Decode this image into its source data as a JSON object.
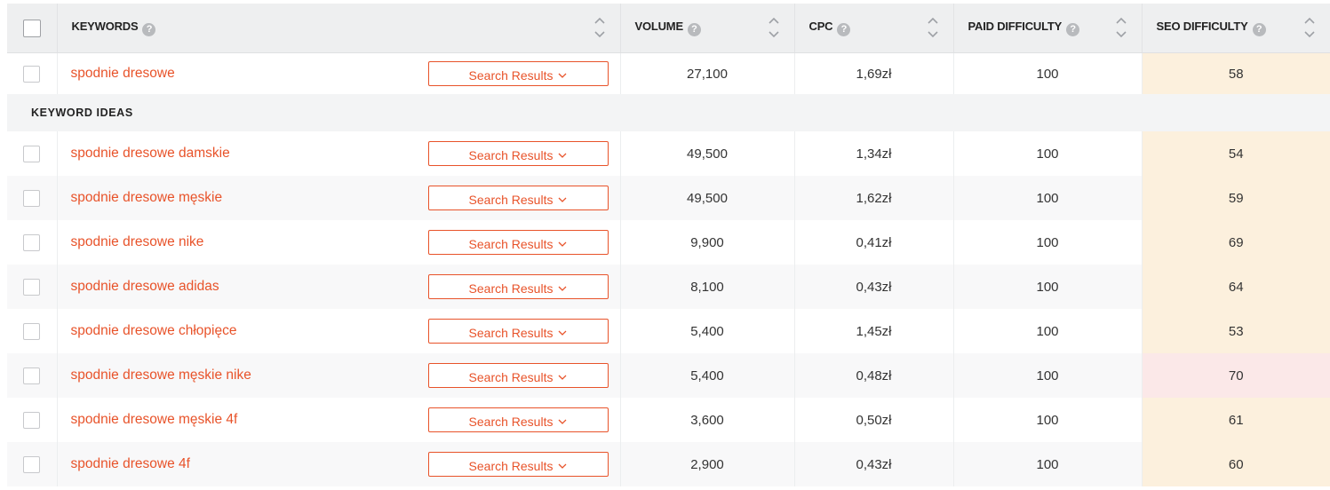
{
  "columns": {
    "keywords": "KEYWORDS",
    "volume": "VOLUME",
    "cpc": "CPC",
    "paid_difficulty": "PAID DIFFICULTY",
    "seo_difficulty": "SEO DIFFICULTY",
    "help_glyph": "?"
  },
  "search_results_label": "Search Results",
  "main_keyword": {
    "keyword": "spodnie dresowe",
    "volume": "27,100",
    "cpc": "1,69zł",
    "paid": "100",
    "seo": "58"
  },
  "section_title": "KEYWORD IDEAS",
  "ideas": [
    {
      "keyword": "spodnie dresowe damskie",
      "volume": "49,500",
      "cpc": "1,34zł",
      "paid": "100",
      "seo": "54"
    },
    {
      "keyword": "spodnie dresowe męskie",
      "volume": "49,500",
      "cpc": "1,62zł",
      "paid": "100",
      "seo": "59"
    },
    {
      "keyword": "spodnie dresowe nike",
      "volume": "9,900",
      "cpc": "0,41zł",
      "paid": "100",
      "seo": "69"
    },
    {
      "keyword": "spodnie dresowe adidas",
      "volume": "8,100",
      "cpc": "0,43zł",
      "paid": "100",
      "seo": "64"
    },
    {
      "keyword": "spodnie dresowe chłopięce",
      "volume": "5,400",
      "cpc": "1,45zł",
      "paid": "100",
      "seo": "53"
    },
    {
      "keyword": "spodnie dresowe męskie nike",
      "volume": "5,400",
      "cpc": "0,48zł",
      "paid": "100",
      "seo": "70"
    },
    {
      "keyword": "spodnie dresowe męskie 4f",
      "volume": "3,600",
      "cpc": "0,50zł",
      "paid": "100",
      "seo": "61"
    },
    {
      "keyword": "spodnie dresowe 4f",
      "volume": "2,900",
      "cpc": "0,43zł",
      "paid": "100",
      "seo": "60"
    }
  ],
  "colors": {
    "accent": "#e8532a",
    "seo_medium": "#fcf0dd",
    "seo_high": "#fbe8e8"
  }
}
